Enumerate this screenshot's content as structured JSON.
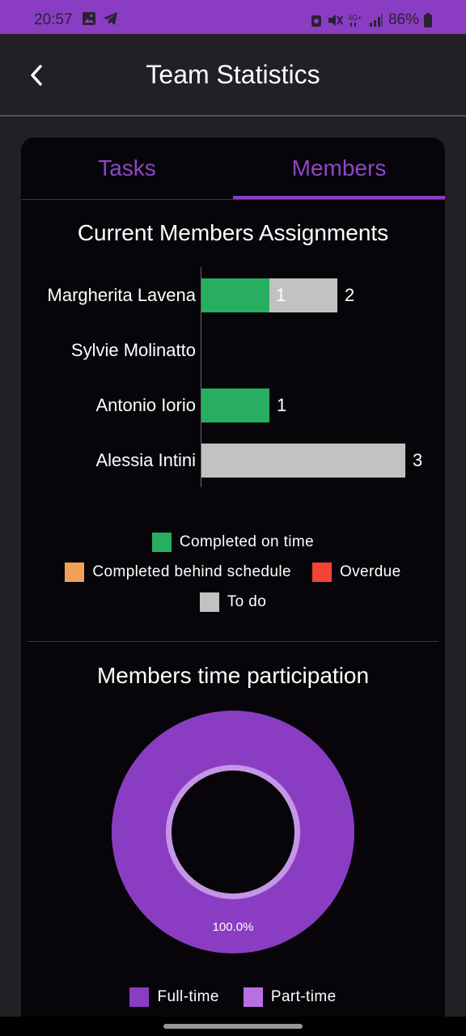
{
  "status_bar": {
    "time": "20:57",
    "battery": "86%",
    "left_icons": [
      "gallery-icon",
      "telegram-icon"
    ],
    "right_icons": [
      "alarm-icon",
      "mute-icon",
      "4g-icon",
      "signal-icon",
      "battery-icon"
    ],
    "color": "#8a3dc3"
  },
  "header": {
    "title": "Team Statistics"
  },
  "tabs": [
    {
      "label": "Tasks",
      "selected": false
    },
    {
      "label": "Members",
      "selected": true
    }
  ],
  "assignments": {
    "title": "Current Members Assignments",
    "members": [
      {
        "name": "Margherita Lavena",
        "completed_on_time": 1,
        "to_do": 1,
        "to_do_label": "1",
        "total": "2"
      },
      {
        "name": "Sylvie Molinatto",
        "completed_on_time": 0,
        "to_do": 0,
        "to_do_label": "",
        "total": ""
      },
      {
        "name": "Antonio Iorio",
        "completed_on_time": 1,
        "to_do": 0,
        "to_do_label": "",
        "total": "1"
      },
      {
        "name": "Alessia Intini",
        "completed_on_time": 0,
        "to_do": 3,
        "to_do_label": "",
        "total": "3"
      }
    ],
    "legend": [
      {
        "label": "Completed on time",
        "color": "#27ae60"
      },
      {
        "label": "Completed behind schedule",
        "color": "#f2a154"
      },
      {
        "label": "Overdue",
        "color": "#f44336"
      },
      {
        "label": "To do",
        "color": "#c2c2c2"
      }
    ]
  },
  "participation": {
    "title": "Members time participation",
    "slice_label": "100.0%",
    "legend": [
      {
        "label": "Full-time",
        "color": "#8a3dc3"
      },
      {
        "label": "Part-time",
        "color": "#b96fe0"
      }
    ]
  },
  "chart_data": [
    {
      "type": "bar",
      "orientation": "horizontal",
      "stacked": true,
      "title": "Current Members Assignments",
      "categories": [
        "Margherita Lavena",
        "Sylvie Molinatto",
        "Antonio Iorio",
        "Alessia Intini"
      ],
      "series": [
        {
          "name": "Completed on time",
          "values": [
            1,
            0,
            1,
            0
          ]
        },
        {
          "name": "Completed behind schedule",
          "values": [
            0,
            0,
            0,
            0
          ]
        },
        {
          "name": "Overdue",
          "values": [
            0,
            0,
            0,
            0
          ]
        },
        {
          "name": "To do",
          "values": [
            1,
            0,
            0,
            3
          ]
        }
      ],
      "totals": [
        2,
        0,
        1,
        3
      ],
      "xlim": [
        0,
        3
      ],
      "legend_position": "bottom"
    },
    {
      "type": "pie",
      "title": "Members time participation",
      "style": "donut",
      "categories": [
        "Full-time",
        "Part-time"
      ],
      "values": [
        100.0,
        0.0
      ],
      "legend_position": "bottom"
    }
  ]
}
